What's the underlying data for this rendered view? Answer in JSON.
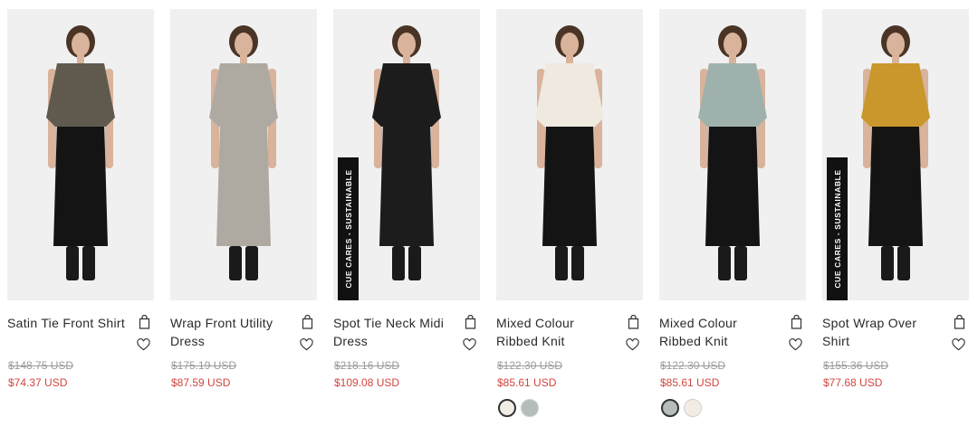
{
  "products": [
    {
      "name": "Satin Tie Front Shirt",
      "old_price": "$148.75 USD",
      "sale_price": "$74.37 USD",
      "top_color": "#5f5a4d",
      "bottom_color": "#141414"
    },
    {
      "name": "Wrap Front Utility Dress",
      "old_price": "$175.19 USD",
      "sale_price": "$87.59 USD",
      "top_color": "#aeaaa2",
      "bottom_color": "#aeaaa2"
    },
    {
      "name": "Spot Tie Neck Midi Dress",
      "old_price": "$218.16 USD",
      "sale_price": "$109.08 USD",
      "badge": "CUE CARES - SUSTAINABLE",
      "top_color": "#1c1c1c",
      "bottom_color": "#1c1c1c"
    },
    {
      "name": "Mixed Colour Ribbed Knit",
      "old_price": "$122.30 USD",
      "sale_price": "$85.61 USD",
      "top_color": "#efe9e0",
      "bottom_color": "#141414",
      "swatches": [
        "#f1ede5",
        "#b5bdbb"
      ],
      "selected_swatch": 0
    },
    {
      "name": "Mixed Colour Ribbed Knit",
      "old_price": "$122.30 USD",
      "sale_price": "$85.61 USD",
      "top_color": "#9fb1ac",
      "bottom_color": "#141414",
      "swatches": [
        "#b5bdbb",
        "#f1ede5"
      ],
      "selected_swatch": 0
    },
    {
      "name": "Spot Wrap Over Shirt",
      "old_price": "$155.36 USD",
      "sale_price": "$77.68 USD",
      "badge": "CUE CARES - SUSTAINABLE",
      "top_color": "#c9972c",
      "bottom_color": "#141414"
    }
  ]
}
